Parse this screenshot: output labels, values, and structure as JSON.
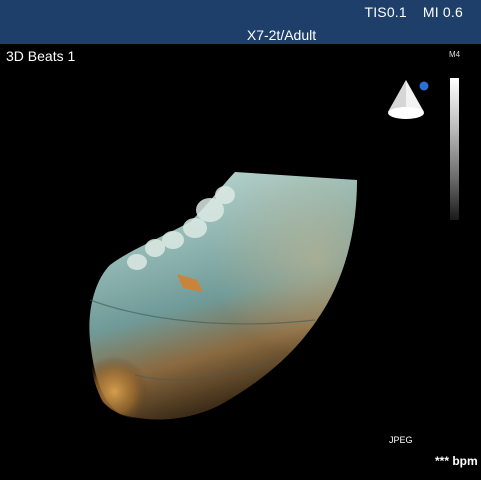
{
  "header": {
    "tis": "TIS0.1",
    "mi": "MI 0.6",
    "probe": "X7-2t/Adult"
  },
  "overlay": {
    "mode": "3D Beats 1",
    "grayscale_label": "M4",
    "format": "JPEG",
    "heart_rate": "*** bpm"
  },
  "icons": {
    "probe_orientation": "3d-cone-orientation-icon",
    "orientation_marker_color": "#2e6fd6"
  },
  "colors": {
    "header_bg": "#1d3f6a",
    "background": "#000000",
    "tissue_light": "#a9c4c4",
    "tissue_warm": "#b07a3a"
  }
}
